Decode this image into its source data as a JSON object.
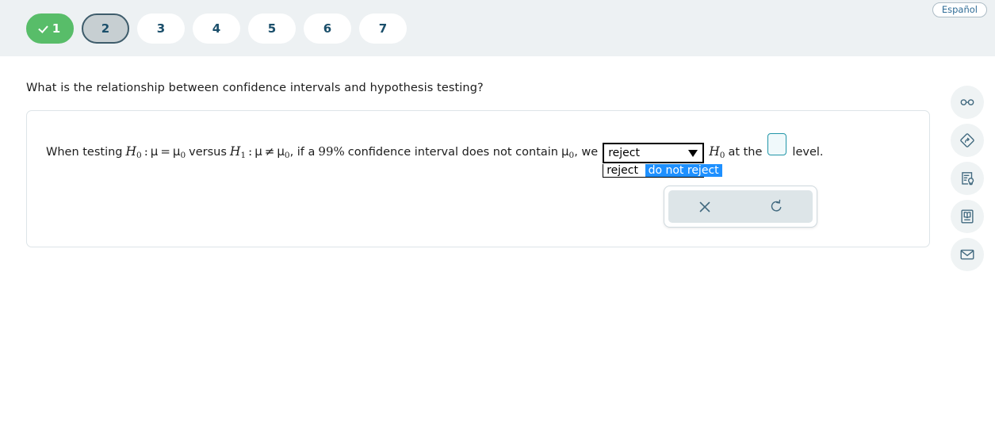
{
  "language_toggle": {
    "label": "Español"
  },
  "steps": [
    {
      "label": "1",
      "state": "done"
    },
    {
      "label": "2",
      "state": "current"
    },
    {
      "label": "3",
      "state": "todo"
    },
    {
      "label": "4",
      "state": "todo"
    },
    {
      "label": "5",
      "state": "todo"
    },
    {
      "label": "6",
      "state": "todo"
    },
    {
      "label": "7",
      "state": "todo"
    }
  ],
  "prompt": {
    "text": "What is the relationship between confidence intervals and hypothesis testing?"
  },
  "statement": {
    "lead": "When testing",
    "h_null": "H",
    "h_null_sub": "0",
    "colon": ":",
    "mu": "μ",
    "equals": "=",
    "mu0": "μ",
    "mu0_sub": "0",
    "versus": "versus",
    "h_alt": "H",
    "h_alt_sub": "1",
    "not_equals": "≠",
    "comma_if": ", if a",
    "confidence_level": "99%",
    "mid": "confidence interval does not contain",
    "mu0_b": "μ",
    "mu0_b_sub": "0",
    "we": ", we",
    "h_null_tail": "H",
    "h_null_tail_sub": "0",
    "at_the": "at the",
    "level": "level."
  },
  "dropdown": {
    "selected_value": "reject",
    "open": true,
    "arrow_icon": "caret-down-icon",
    "options": [
      {
        "label": "reject",
        "selected": false
      },
      {
        "label": "do not reject",
        "selected": true
      }
    ],
    "highlight_color": "#1e90ff"
  },
  "answer_input": {
    "value": "",
    "placeholder": "",
    "border_color": "#2196a8"
  },
  "mini_toolbar": {
    "buttons": [
      {
        "name": "clear-button",
        "icon": "close-x-icon"
      },
      {
        "name": "reset-button",
        "icon": "refresh-ccw-icon"
      }
    ]
  },
  "rail": {
    "items": [
      {
        "name": "glasses-icon",
        "title": "glasses"
      },
      {
        "name": "navigate-diamond-icon",
        "title": "navigate"
      },
      {
        "name": "hint-lightbulb-icon",
        "title": "hint"
      },
      {
        "name": "ebook-icon",
        "title": "ebook"
      },
      {
        "name": "mail-icon",
        "title": "message"
      }
    ]
  },
  "colors": {
    "header_bg": "#edf1f3",
    "step_done": "#58bd69",
    "step_current": "#c7cfd2",
    "accent_text": "#1b4f6b",
    "rail_bg": "#eff3f4"
  }
}
